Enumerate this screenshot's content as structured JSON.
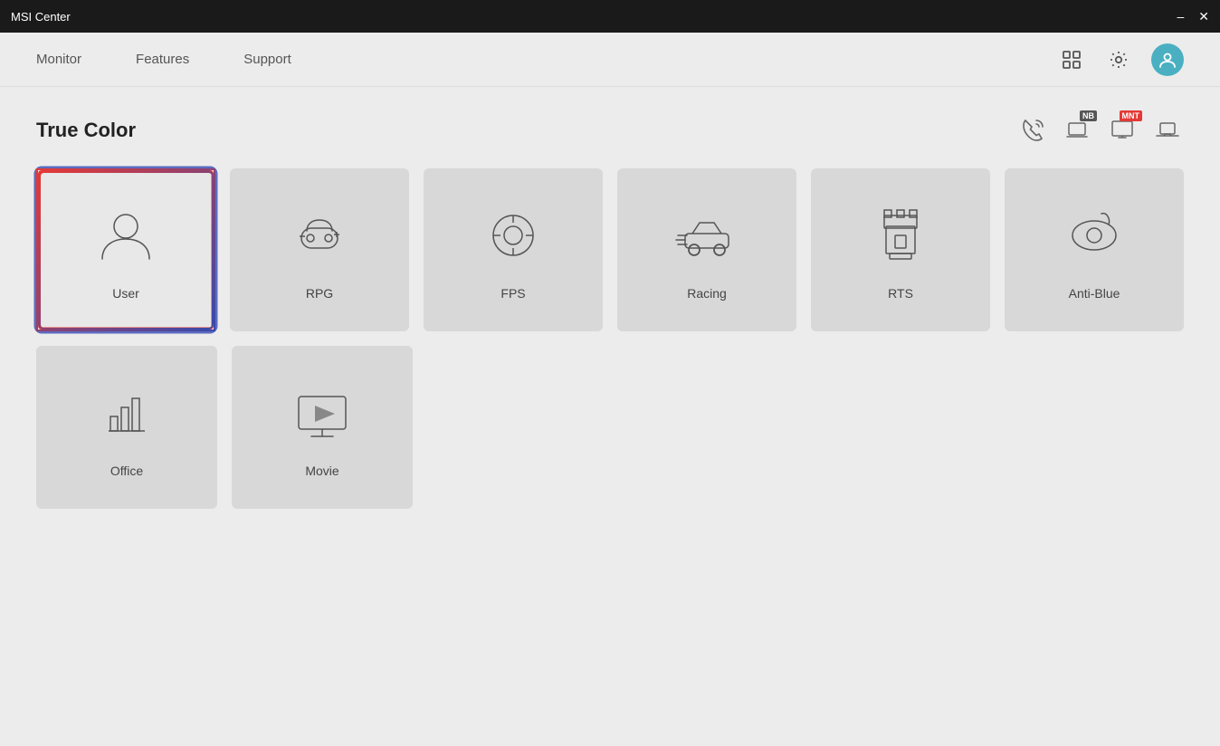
{
  "titlebar": {
    "title": "MSI Center",
    "minimize_label": "–",
    "close_label": "✕"
  },
  "nav": {
    "tabs": [
      {
        "id": "monitor",
        "label": "Monitor"
      },
      {
        "id": "features",
        "label": "Features"
      },
      {
        "id": "support",
        "label": "Support"
      }
    ],
    "icons": {
      "grid": "grid-icon",
      "settings": "settings-icon",
      "profile": "profile-icon"
    }
  },
  "section": {
    "title": "True Color",
    "header_icons": [
      {
        "id": "phone-icon",
        "label": "📞"
      },
      {
        "id": "nb-badge",
        "label": "NB",
        "badge_class": "badge-nb"
      },
      {
        "id": "monitor-badge",
        "label": ""
      },
      {
        "id": "mnt-badge",
        "label": "MNT",
        "badge_class": "badge-mnt"
      },
      {
        "id": "laptop-icon",
        "label": ""
      }
    ]
  },
  "modes": {
    "rows": [
      [
        {
          "id": "user",
          "label": "User",
          "selected": true
        },
        {
          "id": "rpg",
          "label": "RPG",
          "selected": false
        },
        {
          "id": "fps",
          "label": "FPS",
          "selected": false
        },
        {
          "id": "racing",
          "label": "Racing",
          "selected": false
        },
        {
          "id": "rts",
          "label": "RTS",
          "selected": false
        },
        {
          "id": "anti-blue",
          "label": "Anti-Blue",
          "selected": false
        }
      ],
      [
        {
          "id": "office",
          "label": "Office",
          "selected": false
        },
        {
          "id": "movie",
          "label": "Movie",
          "selected": false
        }
      ]
    ]
  }
}
